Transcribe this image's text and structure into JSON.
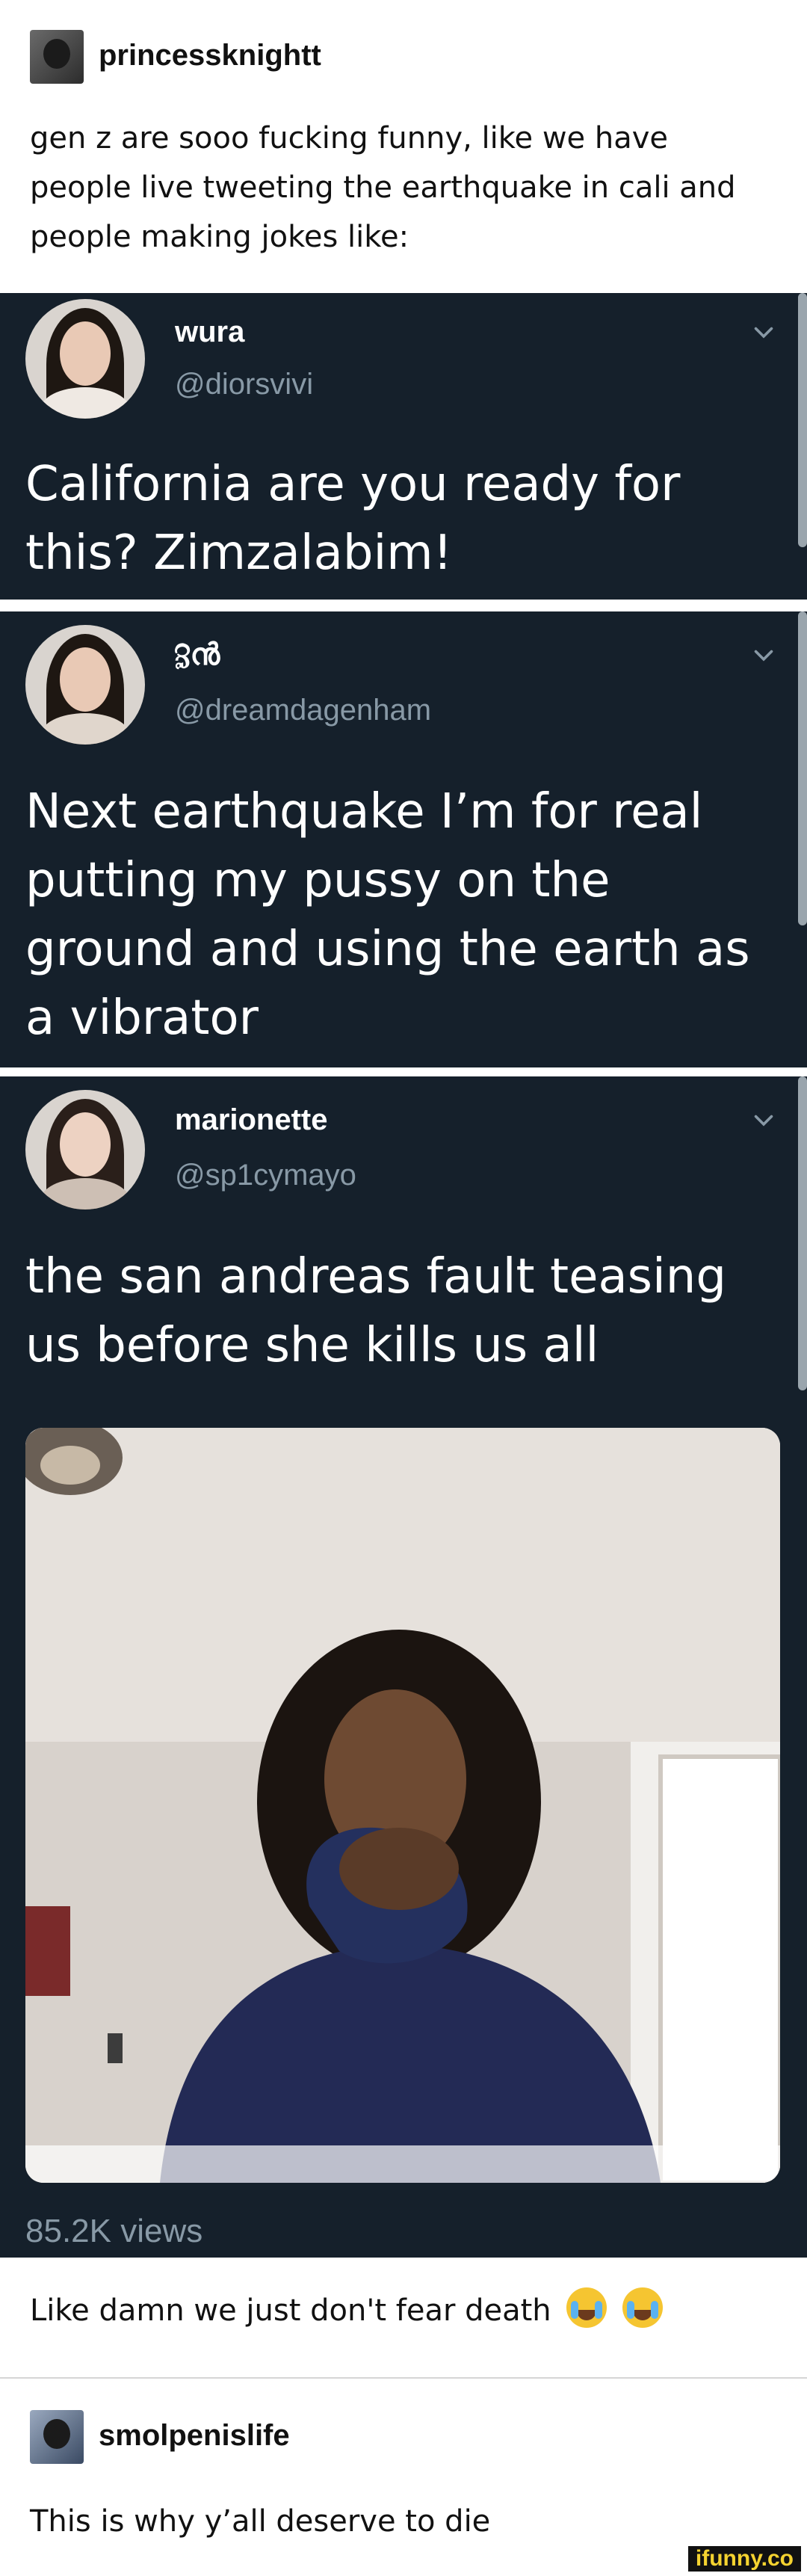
{
  "post1": {
    "username": "princessknightt",
    "text_lines": [
      "gen z are sooo fucking funny, like we have",
      "people live tweeting the earthquake in cali and",
      "people making jokes like:"
    ]
  },
  "tweets": [
    {
      "name": "wura",
      "handle": "@diorsvivi",
      "text_lines": [
        "California are you ready for",
        "this? Zimzalabim!"
      ]
    },
    {
      "name": "ℨൻ",
      "handle": "@dreamdagenham",
      "text_lines": [
        "Next earthquake I’m for real",
        "putting my pussy on the",
        "ground and using the earth as",
        "a vibrator"
      ]
    },
    {
      "name": "marionette",
      "handle": "@sp1cymayo",
      "text_lines": [
        "the san andreas fault teasing",
        "us before she kills us all"
      ],
      "views": "85.2K views"
    }
  ],
  "post1_footer": "Like damn we just don't fear death",
  "post2": {
    "username": "smolpenislife",
    "text": "This is why y’all deserve to die"
  },
  "watermark": "ifunny.co",
  "icons": {
    "chevron": "chevron-down-icon",
    "emoji": "loudly-crying-face-icon"
  },
  "colors": {
    "tweet_bg": "#15202b",
    "handle": "#8899a6"
  }
}
